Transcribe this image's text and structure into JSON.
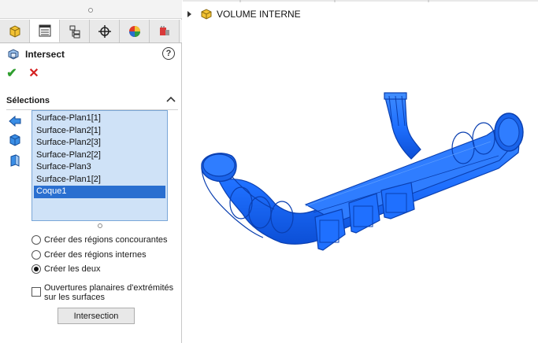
{
  "tabs": [
    {
      "name": "feature-manager",
      "icon": "feature-tree-icon"
    },
    {
      "name": "property-manager",
      "icon": "property-manager-icon",
      "active": true
    },
    {
      "name": "configuration-manager",
      "icon": "configuration-icon"
    },
    {
      "name": "dimxpert-manager",
      "icon": "crosshair-icon"
    },
    {
      "name": "display-manager",
      "icon": "appearance-pie-icon"
    },
    {
      "name": "cam-manager",
      "icon": "cam-icon"
    }
  ],
  "feature": {
    "title": "Intersect",
    "help": "?"
  },
  "actions": {
    "ok": "✔",
    "cancel": "✕"
  },
  "selections": {
    "heading": "Sélections",
    "items": [
      "Surface-Plan1[1]",
      "Surface-Plan2[1]",
      "Surface-Plan2[3]",
      "Surface-Plan2[2]",
      "Surface-Plan3",
      "Surface-Plan1[2]",
      "Coque1"
    ],
    "selected_index": 6
  },
  "options": {
    "radio_concurrent": "Créer des régions concourantes",
    "radio_internal": "Créer des régions internes",
    "radio_both": "Créer les deux",
    "selected": "radio_both",
    "checkbox_label": "Ouvertures planaires d'extrémités sur les surfaces",
    "checkbox_checked": false,
    "button": "Intersection"
  },
  "tree": {
    "label": "VOLUME INTERNE"
  },
  "colors": {
    "accent": "#2a6fd0",
    "model_blue": "#1e72ff",
    "model_edge": "#0a3fb0",
    "list_bg": "#cfe2f7"
  }
}
